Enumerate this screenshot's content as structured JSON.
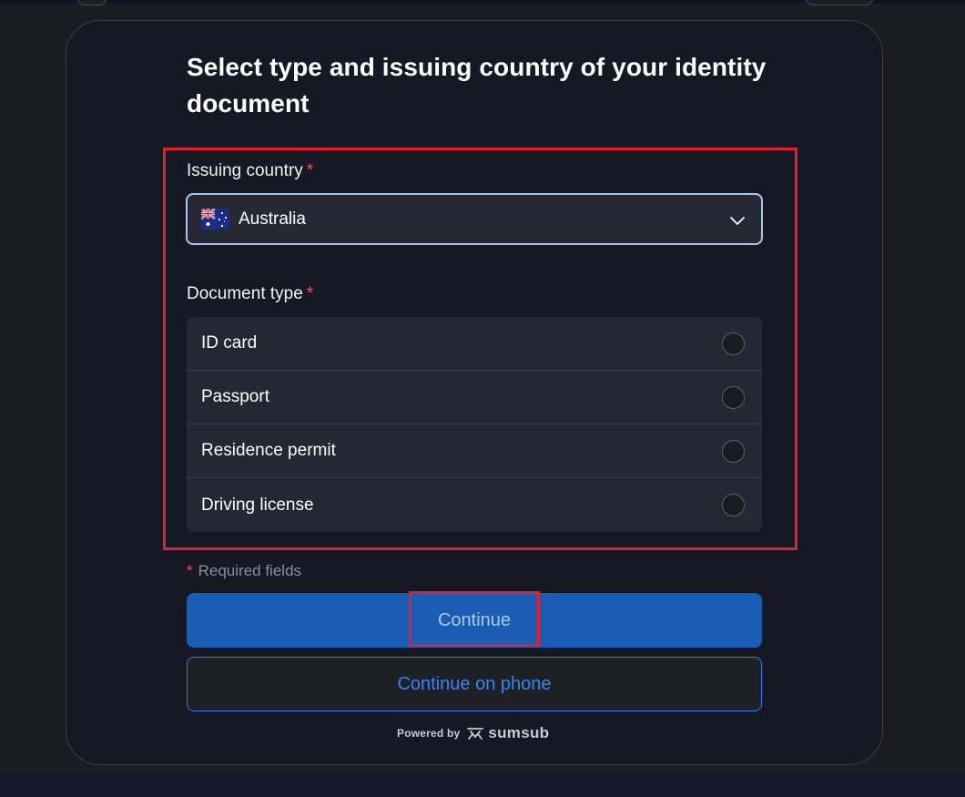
{
  "form": {
    "title": "Select type and issuing country of your identity document",
    "issuing_country": {
      "label": "Issuing country",
      "required_mark": "*",
      "selected": "Australia",
      "flag_icon": "australia-flag-icon"
    },
    "document_type": {
      "label": "Document type",
      "required_mark": "*",
      "options": [
        {
          "label": "ID card",
          "selected": false
        },
        {
          "label": "Passport",
          "selected": false
        },
        {
          "label": "Residence permit",
          "selected": false
        },
        {
          "label": "Driving license",
          "selected": false
        }
      ]
    },
    "required_note": {
      "mark": "*",
      "text": "Required fields"
    },
    "continue_label": "Continue",
    "continue_on_phone_label": "Continue on phone"
  },
  "footer": {
    "powered_by": "Powered by",
    "brand": "sumsub"
  },
  "colors": {
    "background": "#1c1d22",
    "card": "#161823",
    "primary_button": "#1b5db4",
    "accent_blue": "#3088f4",
    "required_red": "#ff4a5a",
    "highlight_red": "#e0202e"
  }
}
